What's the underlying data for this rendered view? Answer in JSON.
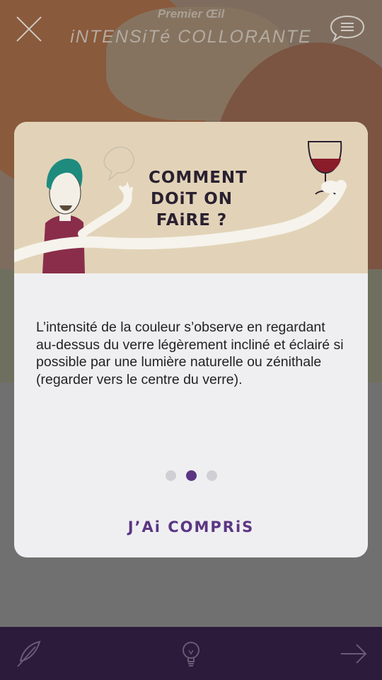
{
  "app": {
    "subtitle": "Premier Œil",
    "title": "iNTENSiTé COLLORANTE"
  },
  "modal": {
    "illustration_title": "COMMENT DOiT ON FAiRE ?",
    "body": "L’intensité de la couleur s’observe en regardant au-dessus du verre légèrement incliné et éclairé si possible par une lumière naturelle ou zénithale (regarder vers le centre du verre).",
    "pager": {
      "count": 3,
      "active": 2
    },
    "confirm_label": "J’Ai COMPRiS"
  },
  "colors": {
    "accent": "#5b3582",
    "bottom_bar": "#2c1b3a",
    "illustration_bg": "#e2d3b8",
    "modal_bg": "#efeff2"
  },
  "icons": {
    "close": "close-icon",
    "menu": "speech-bubble-menu-icon",
    "feather": "feather-icon",
    "bulb": "lightbulb-icon",
    "next": "arrow-right-icon"
  }
}
